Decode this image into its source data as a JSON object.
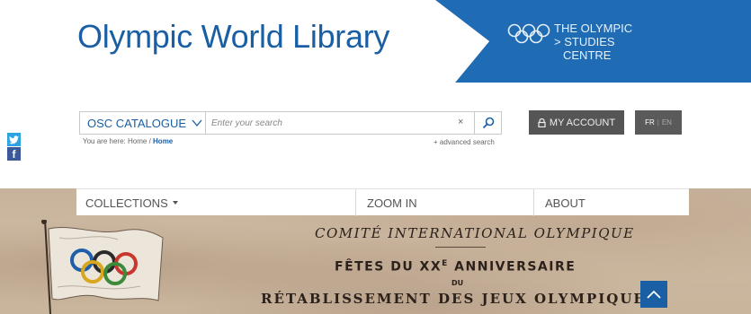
{
  "header": {
    "site_title": "Olympic World Library",
    "osc_lines": [
      "THE OLYMPIC",
      "> STUDIES",
      "CENTRE"
    ]
  },
  "search": {
    "catalogue_label": "OSC CATALOGUE",
    "placeholder": "Enter your search",
    "clear_label": "×",
    "advanced_label": "+ advanced search"
  },
  "breadcrumb": {
    "prefix": "You are here:",
    "home_link": "Home",
    "separator": "/",
    "current": "Home"
  },
  "account": {
    "label": "MY ACCOUNT"
  },
  "language": {
    "fr": "FR",
    "separator": "|",
    "en": "EN"
  },
  "social": {
    "facebook_label": "f"
  },
  "nav": {
    "collections": "COLLECTIONS",
    "zoom": "ZOOM IN",
    "about": "ABOUT"
  },
  "document": {
    "line1": "COMITÉ INTERNATIONAL OLYMPIQUE",
    "line2_pre": "FÊTES DU XX",
    "line2_sup": "E",
    "line2_post": " ANNIVERSAIRE",
    "du": "DU",
    "line3": "RÉTABLISSEMENT DES JEUX OLYMPIQUES"
  },
  "colors": {
    "brand_blue": "#1a5fa3",
    "account_gray": "#555555",
    "parchment": "#c9b49c"
  }
}
